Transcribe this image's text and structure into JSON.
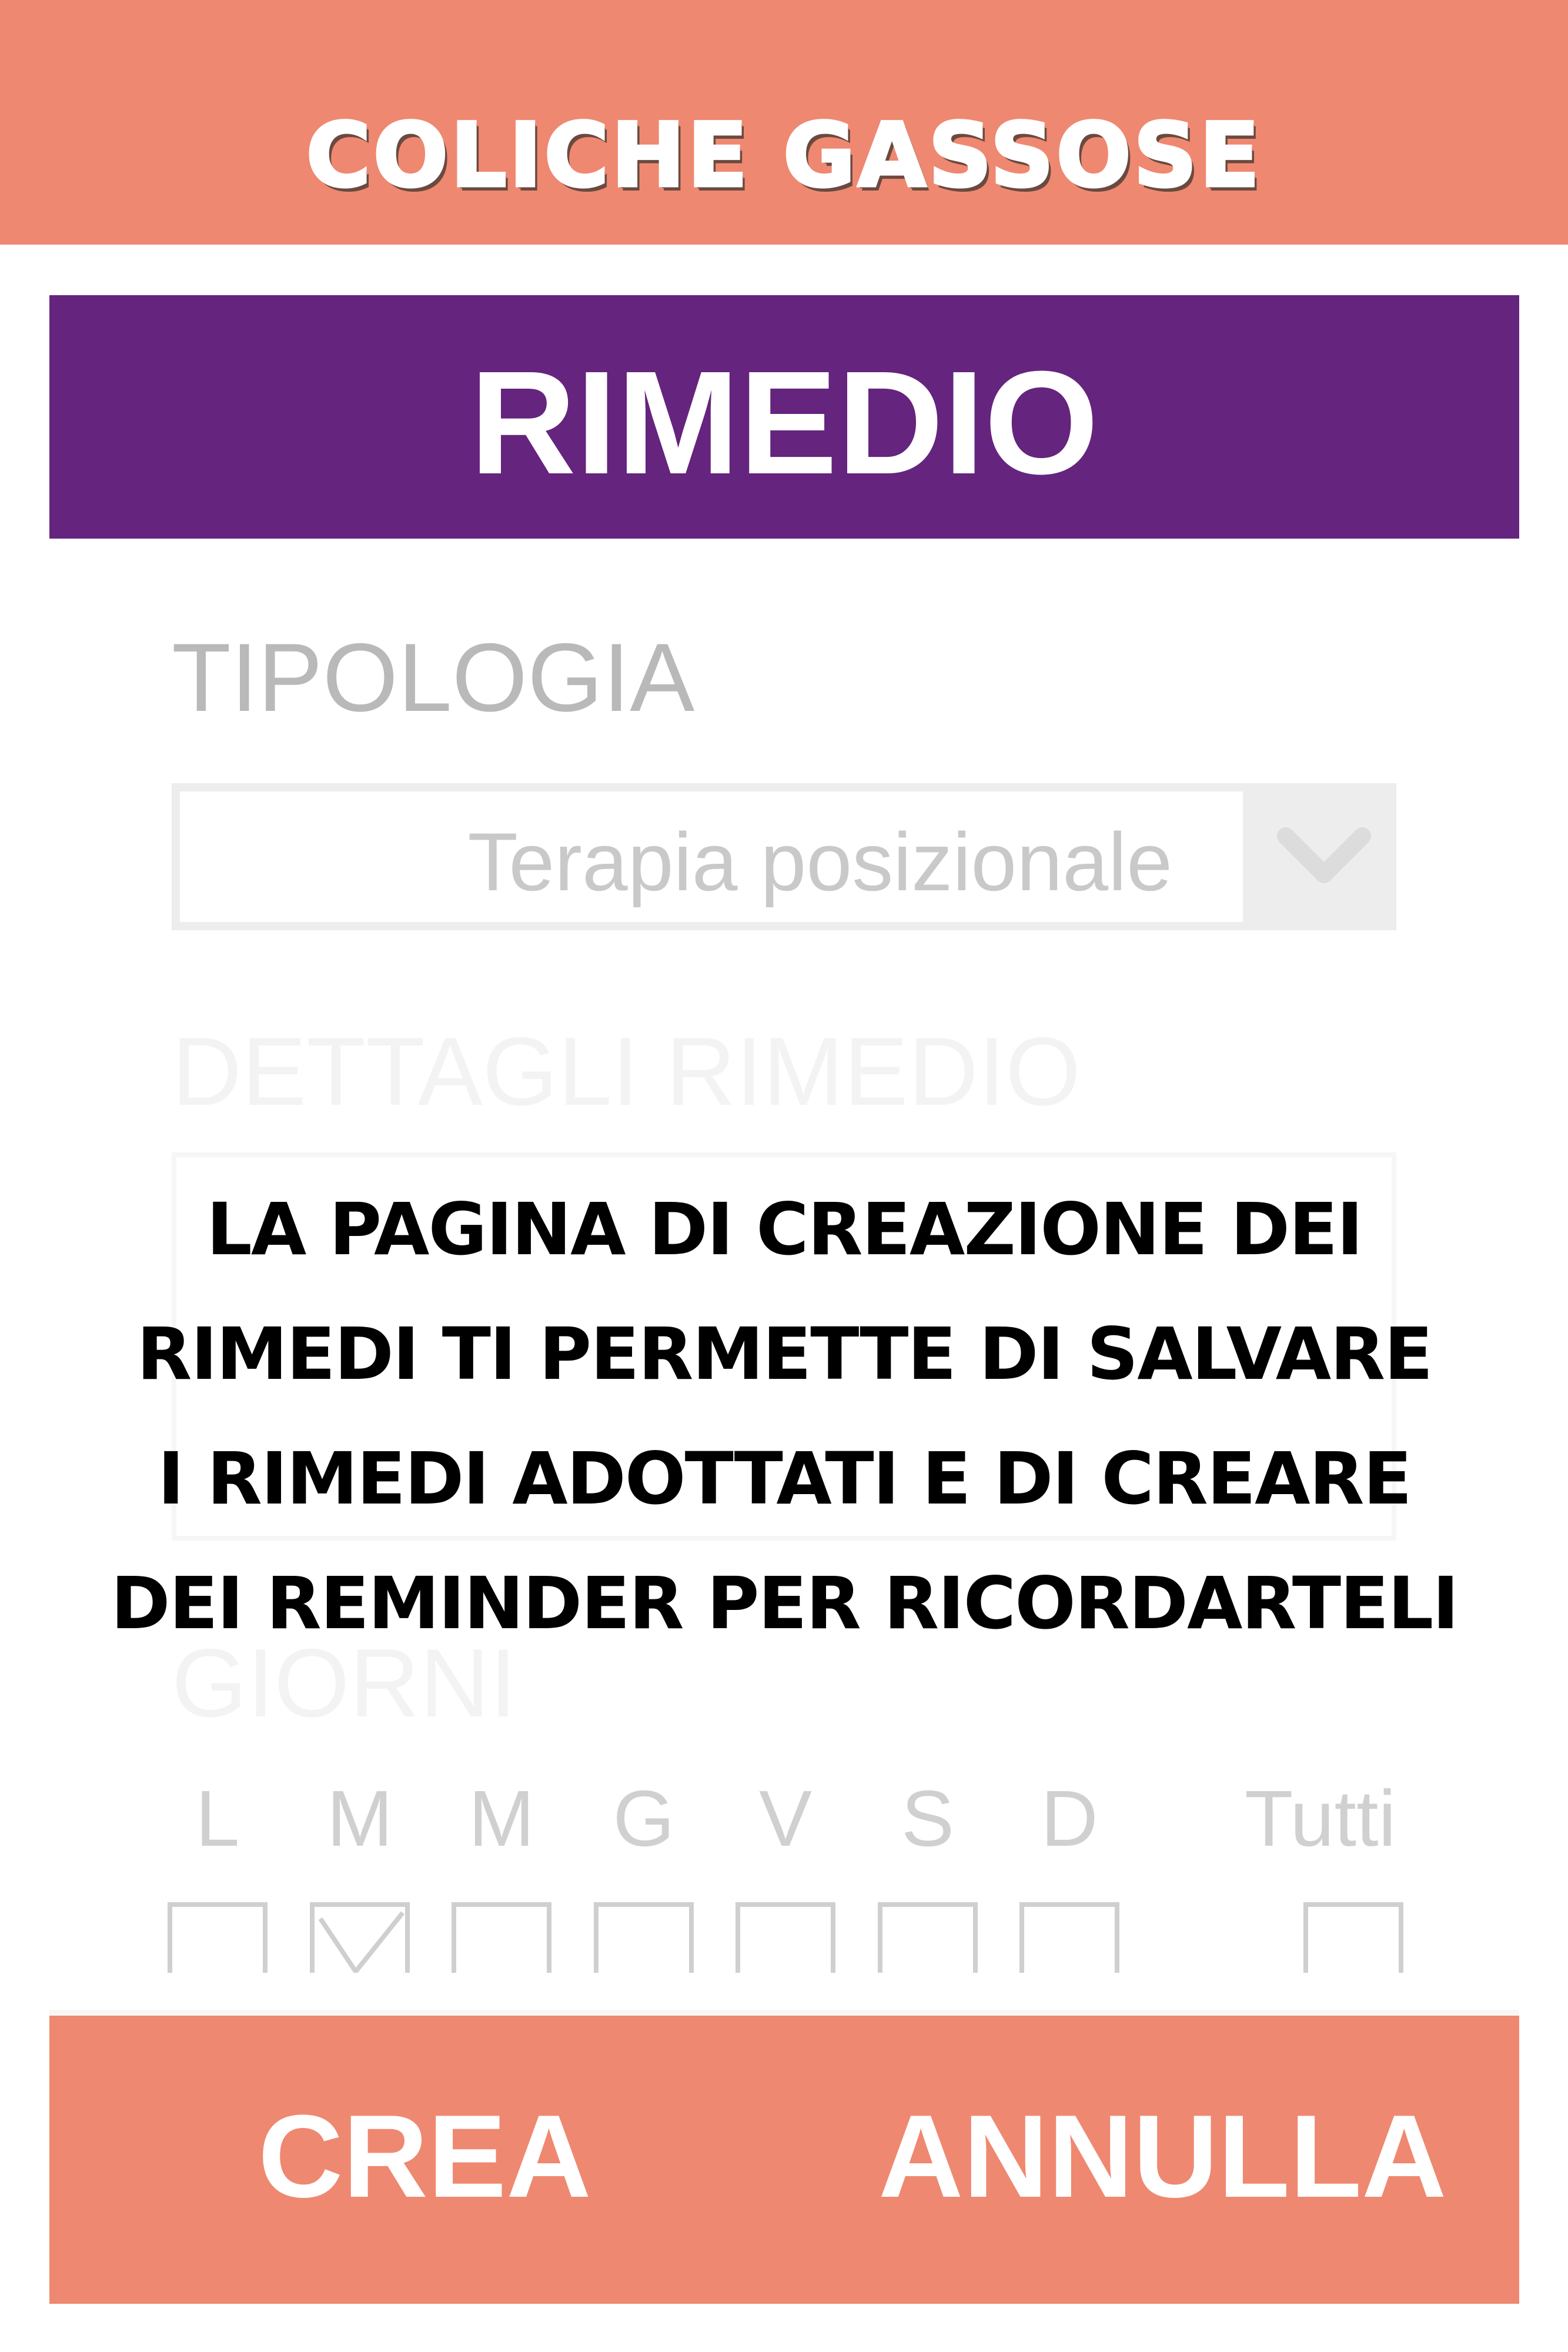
{
  "header": {
    "title": "COLICHE GASSOSE"
  },
  "section": {
    "title": "RIMEDIO"
  },
  "form": {
    "tipologia_label": "TIPOLOGIA",
    "tipologia_value": "Terapia posizionale",
    "dettagli_label": "DETTAGLI RIMEDIO",
    "giorni_label": "GIORNI",
    "days": [
      "L",
      "M",
      "M",
      "G",
      "V",
      "S",
      "D"
    ],
    "all_label": "Tutti"
  },
  "overlay": {
    "lines": [
      "LA PAGINA DI CREAZIONE DEI",
      "RIMEDI TI PERMETTE DI SALVARE",
      "I RIMEDI ADOTTATI E DI CREARE",
      "DEI REMINDER PER RICORDARTELI"
    ]
  },
  "actions": {
    "create_label": "CREA",
    "cancel_label": "ANNULLA"
  },
  "colors": {
    "accent": "#ef8870",
    "section": "#65247d"
  },
  "icons": {
    "dropdown": "chevron-down-icon"
  }
}
